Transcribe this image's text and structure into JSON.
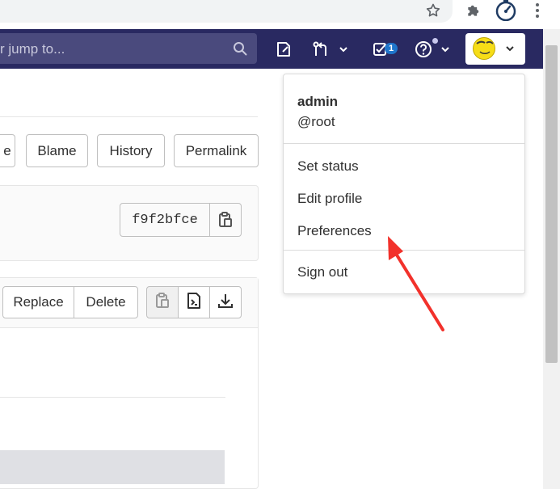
{
  "browser": {
    "bookmark_icon": "star-icon",
    "extensions_icon": "puzzle-icon",
    "profile_icon": "stopwatch-icon",
    "menu_icon": "kebab-menu-icon"
  },
  "navbar": {
    "search_placeholder": "r jump to...",
    "todos_count": "1",
    "colors": {
      "navbar_bg": "#292961",
      "search_bg": "#4a4a7d",
      "badge": "#1f75cb"
    }
  },
  "file_actions": {
    "edit_label": "e",
    "blame_label": "Blame",
    "history_label": "History",
    "permalink_label": "Permalink"
  },
  "commit": {
    "sha": "f9f2bfce"
  },
  "file_header": {
    "replace_label": "Replace",
    "delete_label": "Delete"
  },
  "user_menu": {
    "name": "admin",
    "username": "@root",
    "items": [
      {
        "label": "Set status"
      },
      {
        "label": "Edit profile"
      },
      {
        "label": "Preferences"
      }
    ],
    "sign_out_label": "Sign out"
  },
  "annotation": {
    "color": "#f2312b"
  }
}
